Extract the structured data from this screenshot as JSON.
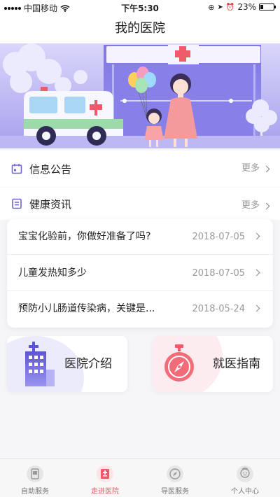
{
  "status_bar": {
    "carrier": "中国移动",
    "time": "下午5:30",
    "battery": "23%",
    "battery_level": 0.23
  },
  "nav": {
    "title": "我的医院"
  },
  "sections": {
    "notice": {
      "label": "信息公告",
      "more": "更多"
    },
    "health": {
      "label": "健康资讯",
      "more": "更多"
    }
  },
  "news": [
    {
      "title": "宝宝化验前，你做好准备了吗?",
      "date": "2018-07-05"
    },
    {
      "title": "儿童发热知多少",
      "date": "2018-07-05"
    },
    {
      "title": "预防小儿肠道传染病，关键是...",
      "date": "2018-05-24"
    }
  ],
  "tiles": {
    "intro": {
      "label": "医院介绍",
      "icon": "hospital-building-icon"
    },
    "guide": {
      "label": "就医指南",
      "icon": "compass-stopwatch-icon"
    }
  },
  "tabbar": {
    "items": [
      {
        "label": "自助服务",
        "icon": "self-service-icon"
      },
      {
        "label": "走进医院",
        "icon": "hospital-icon"
      },
      {
        "label": "导医服务",
        "icon": "compass-icon"
      },
      {
        "label": "个人中心",
        "icon": "profile-icon"
      }
    ],
    "active_index": 1,
    "active_color": "#ee5a6a"
  },
  "colors": {
    "accent": "#ee5a6a",
    "banner_purple": "#a9a4ee",
    "icon_purple": "#6f67d8"
  }
}
